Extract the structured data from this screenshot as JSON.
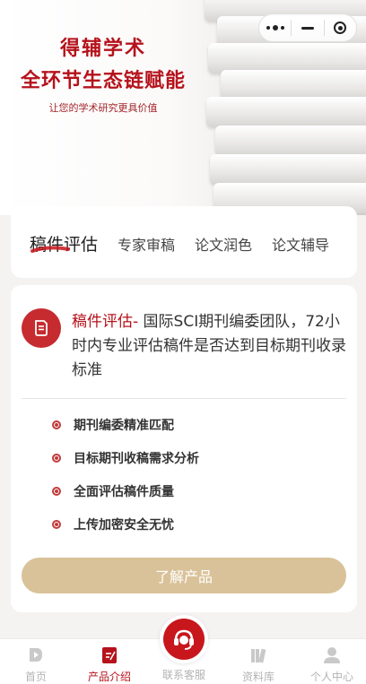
{
  "banner": {
    "title_line1": "得辅学术",
    "title_line2": "全环节生态链赋能",
    "subtitle": "让您的学术研究更具价值"
  },
  "tabs": [
    {
      "label": "稿件评估",
      "active": true
    },
    {
      "label": "专家审稿",
      "active": false
    },
    {
      "label": "论文润色",
      "active": false
    },
    {
      "label": "论文辅导",
      "active": false
    }
  ],
  "product": {
    "highlight": "稿件评估-",
    "description": " 国际SCI期刊编委团队，72小时内专业评估稿件是否达到目标期刊收录标准",
    "features": [
      "期刊编委精准匹配",
      "目标期刊收稿需求分析",
      "全面评估稿件质量",
      "上传加密安全无忧"
    ],
    "button_label": "了解产品"
  },
  "nav": {
    "items": [
      {
        "label": "首页",
        "icon": "home-icon",
        "active": false
      },
      {
        "label": "产品介绍",
        "icon": "product-icon",
        "active": true
      },
      {
        "label": "联系客服",
        "icon": "headset-icon",
        "active": false
      },
      {
        "label": "资料库",
        "icon": "library-icon",
        "active": false
      },
      {
        "label": "个人中心",
        "icon": "user-icon",
        "active": false
      }
    ]
  },
  "colors": {
    "brand_red": "#b5121b",
    "button_gold": "#d9c299"
  }
}
